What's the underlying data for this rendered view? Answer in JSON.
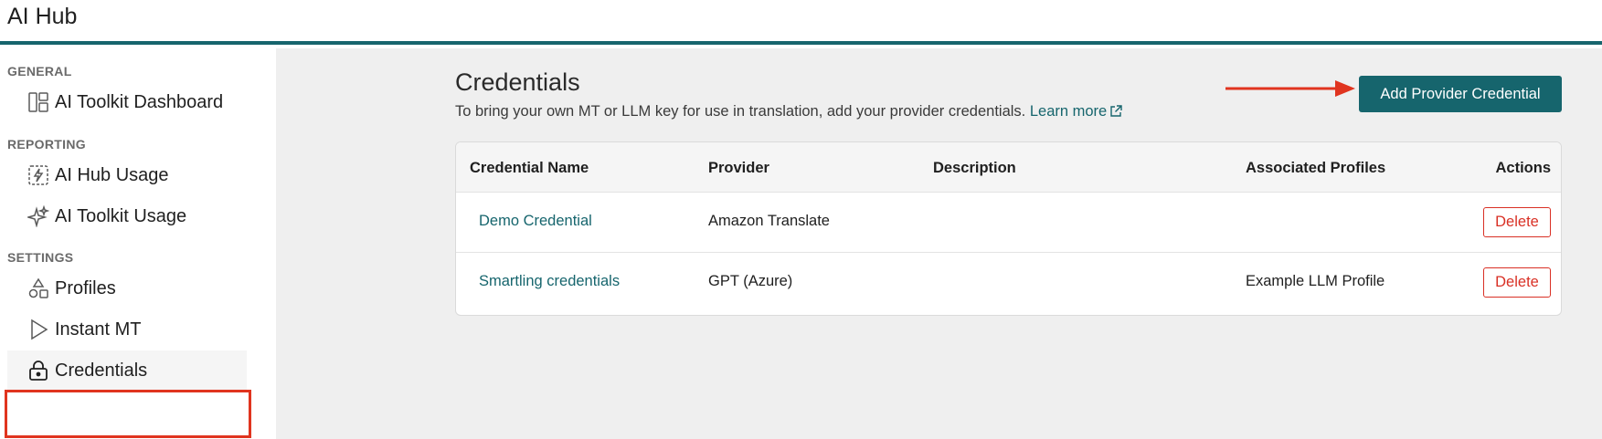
{
  "app": {
    "title": "AI Hub"
  },
  "sidebar": {
    "sections": [
      {
        "label": "GENERAL",
        "items": [
          {
            "label": "AI Toolkit Dashboard",
            "icon": "dashboard-icon"
          }
        ]
      },
      {
        "label": "REPORTING",
        "items": [
          {
            "label": "AI Hub Usage",
            "icon": "usage-chart-icon"
          },
          {
            "label": "AI Toolkit Usage",
            "icon": "sparkle-icon"
          }
        ]
      },
      {
        "label": "SETTINGS",
        "items": [
          {
            "label": "Profiles",
            "icon": "shapes-icon"
          },
          {
            "label": "Instant MT",
            "icon": "play-icon"
          },
          {
            "label": "Credentials",
            "icon": "lock-icon",
            "active": true
          }
        ]
      }
    ]
  },
  "main": {
    "title": "Credentials",
    "description": "To bring your own MT or LLM key for use in translation, add your provider credentials.",
    "learn_more": "Learn more",
    "add_button": "Add Provider Credential",
    "table": {
      "headers": [
        "Credential Name",
        "Provider",
        "Description",
        "Associated Profiles",
        "Actions"
      ],
      "rows": [
        {
          "name": "Demo Credential",
          "provider": "Amazon Translate",
          "description": "",
          "profiles": "",
          "action": "Delete"
        },
        {
          "name": "Smartling credentials",
          "provider": "GPT (Azure)",
          "description": "",
          "profiles": "Example LLM Profile",
          "action": "Delete"
        }
      ]
    }
  },
  "colors": {
    "brand": "#16656d",
    "annotation": "#e0341f",
    "danger": "#d93025"
  }
}
